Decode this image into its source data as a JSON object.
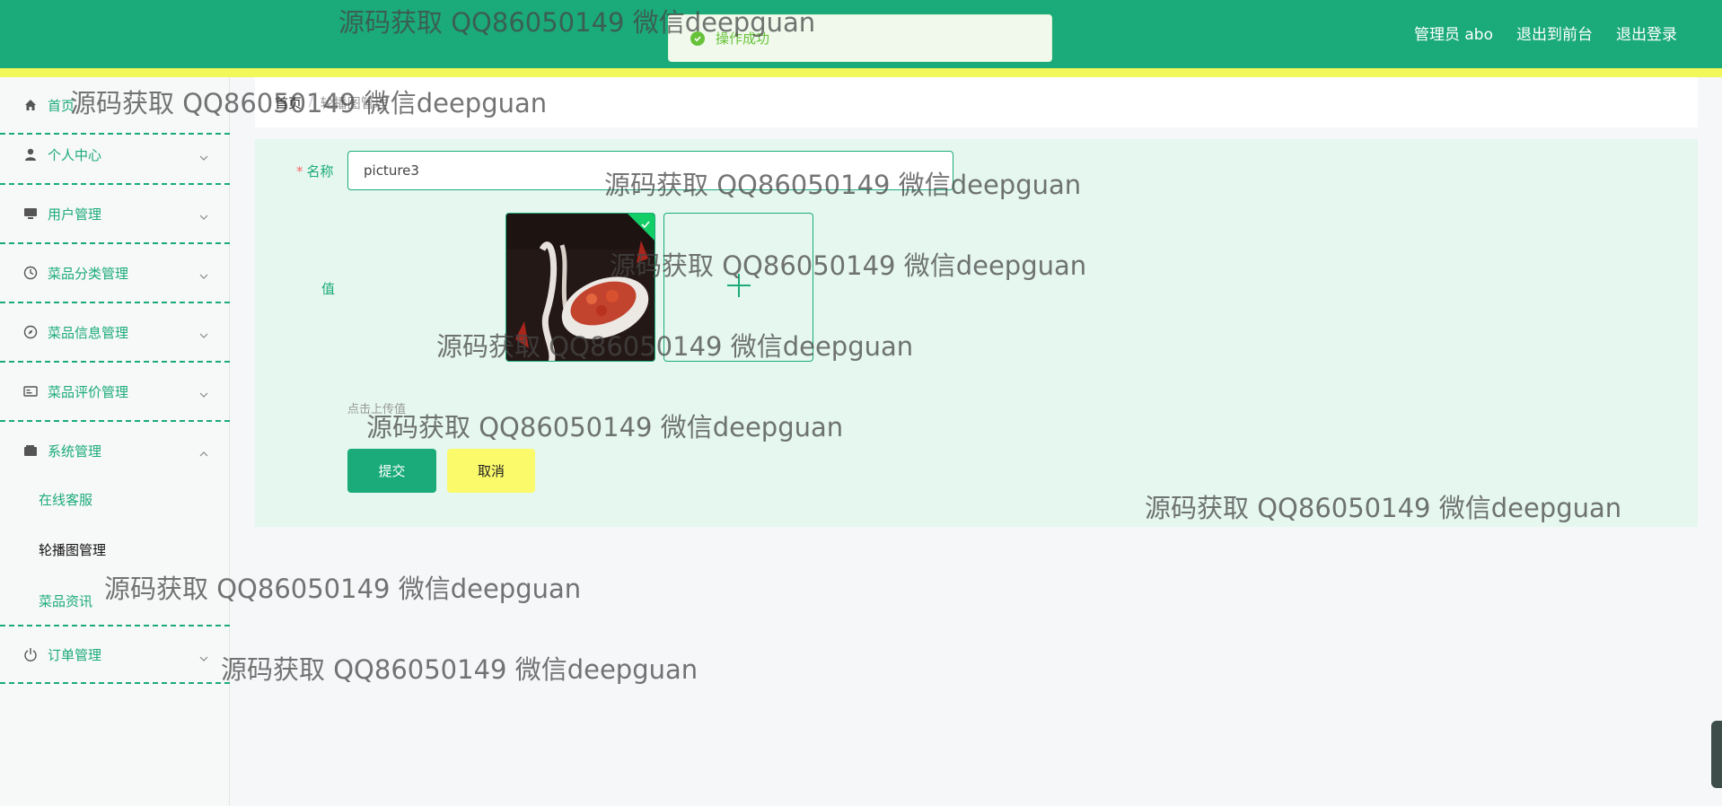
{
  "header": {
    "nav": [
      "管理员 abo",
      "退出到前台",
      "退出登录"
    ]
  },
  "toast": {
    "text": "操作成功",
    "icon": "check-circle-icon",
    "color": "#67c23a"
  },
  "sidebar": {
    "items": [
      {
        "label": "首页",
        "icon": "home-icon"
      },
      {
        "label": "个人中心",
        "icon": "user-icon"
      },
      {
        "label": "用户管理",
        "icon": "monitor-icon"
      },
      {
        "label": "菜品分类管理",
        "icon": "clock-icon"
      },
      {
        "label": "菜品信息管理",
        "icon": "compass-icon"
      },
      {
        "label": "菜品评价管理",
        "icon": "card-icon"
      },
      {
        "label": "系统管理",
        "icon": "wallet-icon"
      },
      {
        "label": "订单管理",
        "icon": "power-icon"
      }
    ],
    "submenu": [
      "在线客服",
      "轮播图管理",
      "菜品资讯"
    ]
  },
  "breadcrumb": {
    "home": "首页",
    "current": "轮播图管理"
  },
  "form": {
    "name_label": "名称",
    "name_value": "picture3",
    "value_label": "值",
    "upload_hint": "点击上传值",
    "submit_label": "提交",
    "cancel_label": "取消"
  },
  "watermark": "源码获取 QQ86050149 微信deepguan",
  "colors": {
    "primary": "#1bab7a",
    "accent": "#f2f75a"
  }
}
